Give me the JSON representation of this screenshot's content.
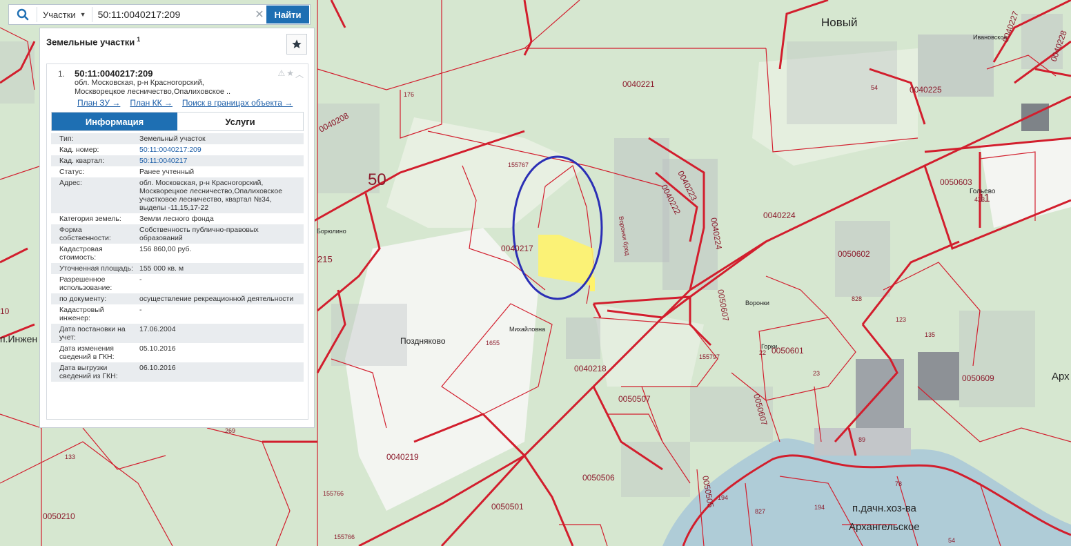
{
  "search": {
    "layer_label": "Участки",
    "query_value": "50:11:0040217:209",
    "find_label": "Найти"
  },
  "panel": {
    "title": "Земельные участки",
    "title_sup": "1",
    "result": {
      "num": "1.",
      "cad_number": "50:11:0040217:209",
      "address_line1": "обл. Московская, р-н Красногорский,",
      "address_line2": "Москворецкое лесничество,Опалиховское .."
    },
    "links": [
      "План ЗУ →",
      "План КК →",
      "Поиск в границах объекта →"
    ],
    "tabs": [
      "Информация",
      "Услуги"
    ],
    "properties": [
      {
        "key": "Тип:",
        "value": "Земельный участок"
      },
      {
        "key": "Кад. номер:",
        "value": "50:11:0040217:209"
      },
      {
        "key": "Кад. квартал:",
        "value": "50:11:0040217"
      },
      {
        "key": "Статус:",
        "value": "Ранее учтенный"
      },
      {
        "key": "Адрес:",
        "value": "обл. Московская, р-н Красногорский, Москворецкое лесничество,Опалиховское участковое лесничество, квартал №34, выделы -11,15,17-22"
      },
      {
        "key": "Категория земель:",
        "value": "Земли лесного фонда"
      },
      {
        "key": "Форма собственности:",
        "value": "Собственность публично-правовых образований"
      },
      {
        "key": "Кадастровая стоимость:",
        "value": "156 860,00 руб."
      },
      {
        "key": "Уточненная площадь:",
        "value": "155 000 кв. м"
      },
      {
        "key": "Разрешенное использование:",
        "value": "-"
      },
      {
        "key": "по документу:",
        "value": "осуществление рекреационной деятельности"
      },
      {
        "key": "Кадастровый инженер:",
        "value": "-"
      },
      {
        "key": "Дата постановки на учет:",
        "value": "17.06.2004"
      },
      {
        "key": "Дата изменения сведений в ГКН:",
        "value": "05.10.2016"
      },
      {
        "key": "Дата выгрузки сведений из ГКН:",
        "value": "06.10.2016"
      }
    ]
  },
  "map": {
    "labels_large": [
      "50",
      "Новый",
      "Поздняково",
      "п.дачн.хоз-ва",
      "Архангельское",
      "п.Инжен",
      "Арх",
      "11"
    ],
    "labels_small": [
      "Михайловна",
      "Воронки",
      "Горки",
      "Ивановское",
      "Гольево",
      "Борюлино",
      "Воронки брод"
    ],
    "quarters": [
      "0040208",
      "0040221",
      "0040217",
      "0040218",
      "0040219",
      "0040223",
      "0040222",
      "0040224",
      "0040225",
      "0040227",
      "0040228",
      "0050603",
      "0050602",
      "0050601",
      "0050609",
      "0050507",
      "0050506",
      "0050505",
      "0050501",
      "0050210",
      "0050607",
      "0040224",
      "215",
      "0050607"
    ],
    "numbers": [
      "176",
      "155767",
      "1655",
      "155797",
      "155766",
      "155766",
      "423",
      "828",
      "123",
      "135",
      "23",
      "22",
      "89",
      "78",
      "194",
      "827",
      "194",
      "54",
      "54",
      "133",
      "269",
      "10"
    ],
    "colors": {
      "boundary": "#d21e2d",
      "selected_fill": "#fff36b",
      "highlight_circle": "#2b2fb5",
      "forest": "#cfe2c6",
      "field": "#f6f7f4"
    }
  }
}
